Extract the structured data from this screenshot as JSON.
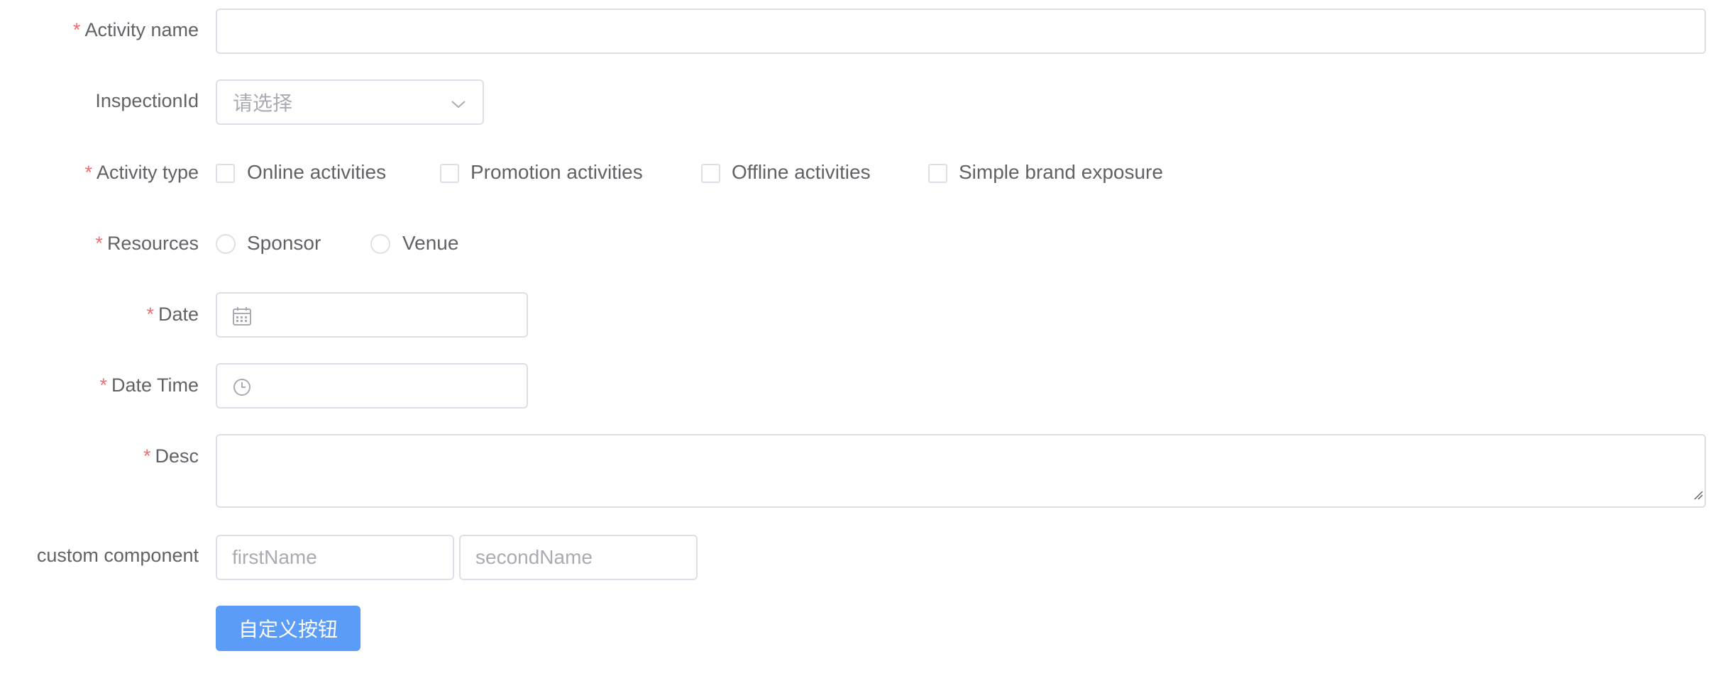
{
  "form": {
    "activity_name": {
      "required": "*",
      "label": "Activity name",
      "value": ""
    },
    "inspection_id": {
      "label": "InspectionId",
      "placeholder": "请选择",
      "icon": "chevron-down-icon"
    },
    "activity_type": {
      "required": "*",
      "label": "Activity type",
      "options": [
        {
          "label": "Online activities",
          "checked": false
        },
        {
          "label": "Promotion activities",
          "checked": false
        },
        {
          "label": "Offline activities",
          "checked": false
        },
        {
          "label": "Simple brand exposure",
          "checked": false
        }
      ]
    },
    "resources": {
      "required": "*",
      "label": "Resources",
      "options": [
        {
          "label": "Sponsor",
          "selected": false
        },
        {
          "label": "Venue",
          "selected": false
        }
      ]
    },
    "date": {
      "required": "*",
      "label": "Date",
      "value": "",
      "icon": "calendar-icon"
    },
    "date_time": {
      "required": "*",
      "label": "Date Time",
      "value": "",
      "icon": "clock-icon"
    },
    "desc": {
      "required": "*",
      "label": "Desc",
      "value": ""
    },
    "custom_component": {
      "label": "custom component",
      "first_placeholder": "firstName",
      "second_placeholder": "secondName"
    },
    "custom_button": {
      "label": "自定义按钮"
    }
  },
  "colors": {
    "required_star": "#f56c6c",
    "label_text": "#606266",
    "border": "#dcdfe6",
    "placeholder": "#a8abb2",
    "primary_button": "#5a9cf8"
  }
}
